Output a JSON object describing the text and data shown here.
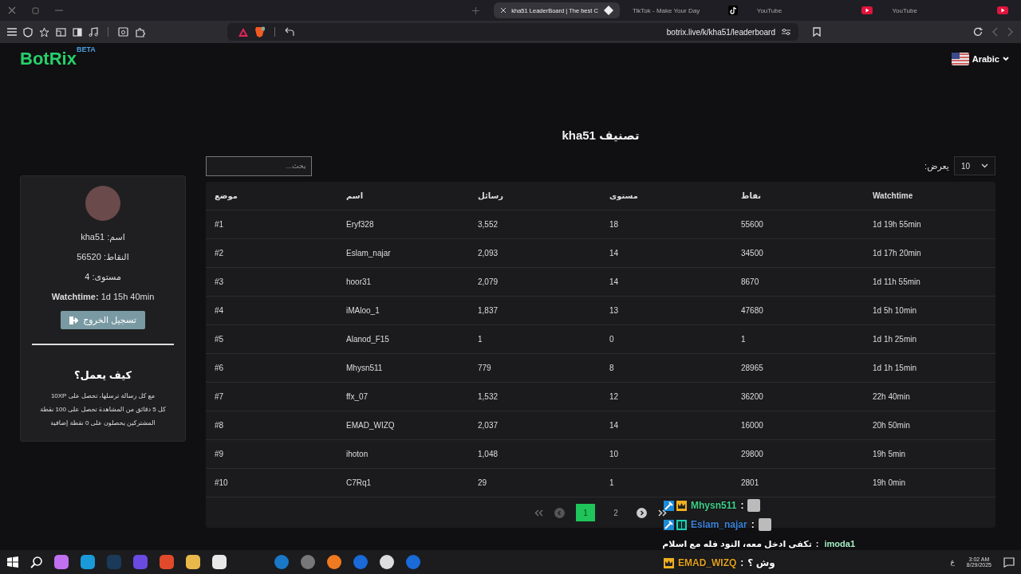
{
  "browser": {
    "tabs": [
      {
        "label": "kha51 LeaderBoard | The best C",
        "selected": true,
        "kind": "site"
      },
      {
        "label": "TikTok - Make Your Day",
        "selected": false,
        "kind": "tiktok"
      },
      {
        "label": "YouTube",
        "selected": false,
        "kind": "youtube"
      },
      {
        "label": "YouTube",
        "selected": false,
        "kind": "youtube"
      }
    ],
    "url": "botrix.live/k/kha51/leaderboard"
  },
  "header": {
    "logo": "BotRix",
    "logo_badge": "BETA",
    "language": "Arabic"
  },
  "sidebar": {
    "profile_lines": [
      "اسم: kha51",
      "النقاط: 56520",
      "مستوى: 4"
    ],
    "watchtime": "**Watchtime:** 1d 15h 40min",
    "logout_button": "تسجيل الخروج",
    "how_title": "كيف يعمل؟",
    "how_lines": [
      "مع كل رسالة ترسلها، تحصل على 10XP",
      "كل 5 دقائق من المشاهدة تحصل على 100 نقطة",
      "المشتركين يحصلون على 0 نقطة إضافية"
    ]
  },
  "leaderboard": {
    "title": "تصنيف kha51",
    "search": {
      "placeholder": "بحث..."
    },
    "per_page": {
      "label": "يعرض:",
      "value": "10"
    },
    "columns": [
      "موضع",
      "اسم",
      "رسائل",
      "مستوى",
      "نقاط",
      "Watchtime"
    ],
    "rows": [
      [
        "#1",
        "Eryf328",
        "3,552",
        "18",
        "55600",
        "1d 19h 55min"
      ],
      [
        "#2",
        "Eslam_najar",
        "2,093",
        "14",
        "34500",
        "1d 17h 20min"
      ],
      [
        "#3",
        "hoor31",
        "2,079",
        "14",
        "8670",
        "1d 11h 55min"
      ],
      [
        "#4",
        "iMAloo_1",
        "1,837",
        "13",
        "47680",
        "1d 5h 10min"
      ],
      [
        "#5",
        "Alanod_F15",
        "1",
        "0",
        "1",
        "1d 1h 25min"
      ],
      [
        "#6",
        "Mhysn511",
        "779",
        "8",
        "28965",
        "1d 1h 15min"
      ],
      [
        "#7",
        "ffx_07",
        "1,532",
        "12",
        "36200",
        "22h 40min"
      ],
      [
        "#8",
        "EMAD_WIZQ",
        "2,037",
        "14",
        "16000",
        "20h 50min"
      ],
      [
        "#9",
        "ihoton",
        "1,048",
        "10",
        "29800",
        "19h 5min"
      ],
      [
        "#10",
        "C7Rq1",
        "29",
        "1",
        "2801",
        "19h 0min"
      ]
    ],
    "pages": [
      {
        "label": "1",
        "selected": true
      },
      {
        "label": "2",
        "selected": false
      }
    ]
  },
  "chat": [
    {
      "user": "Mhysn511",
      "color": "#3fd08a",
      "moderator": true,
      "crown": true,
      "subscriber": false,
      "separator": ":",
      "emote": true,
      "rtl": false
    },
    {
      "user": "Eslam_najar",
      "color": "#3b82d8",
      "moderator": true,
      "crown": false,
      "subscriber": true,
      "separator": ":",
      "emote": true,
      "rtl": false
    },
    {
      "user": "imoda1",
      "color": "#a8f0c8",
      "moderator": false,
      "crown": false,
      "subscriber": false,
      "separator": ":",
      "message": "تكفى ادخل معه، النود فله مع اسلام",
      "emote": false,
      "rtl": true
    },
    {
      "user": "EMAD_WIZQ",
      "color": "#e0a020",
      "moderator": false,
      "crown": true,
      "subscriber": false,
      "separator": ":",
      "message": "وش ؟",
      "emote": false,
      "rtl": false
    }
  ],
  "taskbar": {
    "input_language": "ع",
    "time": "3:02 AM",
    "date": "8/29/2025"
  }
}
